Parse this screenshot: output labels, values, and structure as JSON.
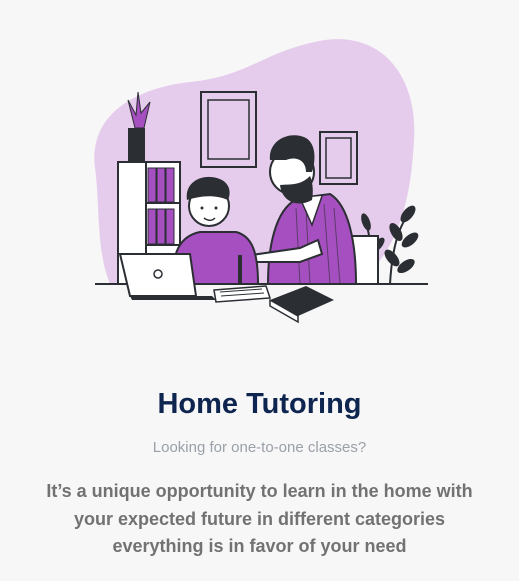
{
  "card": {
    "title": "Home Tutoring",
    "subtitle": "Looking for one-to-one classes?",
    "description": "It’s a unique opportunity to learn in the home with your expected future in different categories everything is in favor of your need"
  },
  "colors": {
    "accent_purple": "#a64fc0",
    "blob_lavender": "#e6ccec",
    "title_navy": "#0e2550",
    "outline_dark": "#2b2e33"
  },
  "illustration": {
    "icon": "tutoring-illustration"
  }
}
